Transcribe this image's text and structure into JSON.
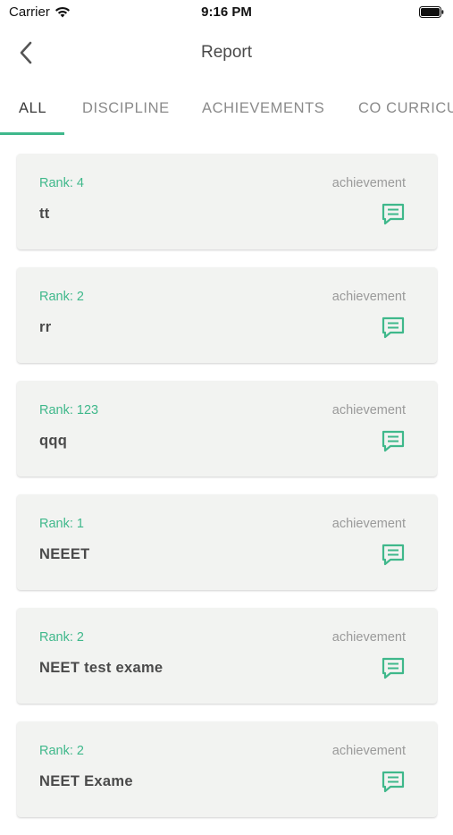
{
  "status_bar": {
    "carrier": "Carrier",
    "time": "9:16 PM"
  },
  "header": {
    "title": "Report"
  },
  "tabs": [
    {
      "label": "ALL",
      "active": true
    },
    {
      "label": "DISCIPLINE",
      "active": false
    },
    {
      "label": "ACHIEVEMENTS",
      "active": false
    },
    {
      "label": "CO CURRICULAR",
      "active": false
    }
  ],
  "colors": {
    "accent": "#3fb88b",
    "card_bg": "#f2f3f1"
  },
  "reports": [
    {
      "rank": "Rank: 4",
      "type": "achievement",
      "title": "tt",
      "icon": "message-icon"
    },
    {
      "rank": "Rank: 2",
      "type": "achievement",
      "title": "rr",
      "icon": "message-icon"
    },
    {
      "rank": "Rank: 123",
      "type": "achievement",
      "title": "qqq",
      "icon": "message-icon"
    },
    {
      "rank": "Rank: 1",
      "type": "achievement",
      "title": "NEEET",
      "icon": "message-icon"
    },
    {
      "rank": "Rank: 2",
      "type": "achievement",
      "title": "NEET test exame",
      "icon": "message-icon"
    },
    {
      "rank": "Rank: 2",
      "type": "achievement",
      "title": "NEET Exame",
      "icon": "message-icon"
    }
  ]
}
